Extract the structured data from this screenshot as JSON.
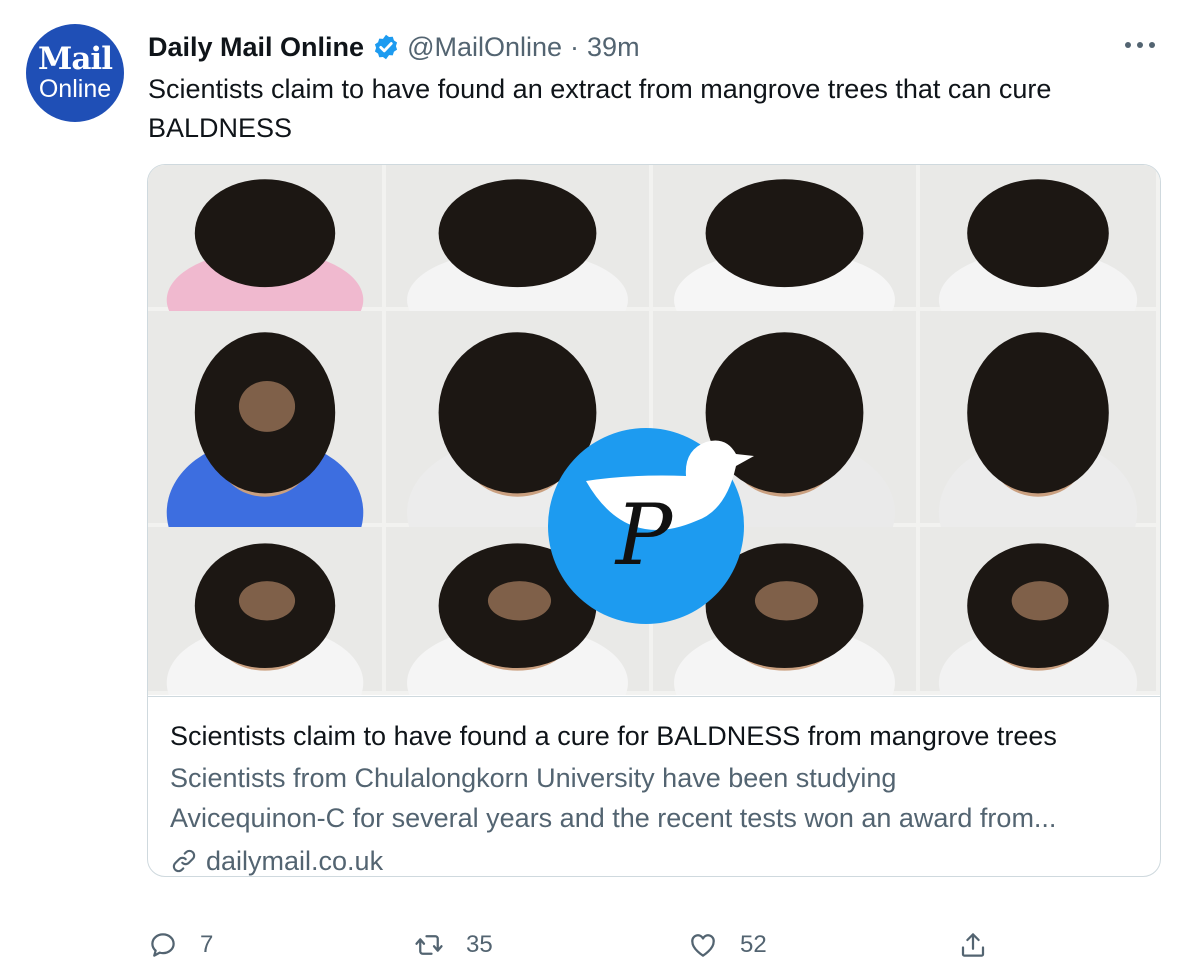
{
  "account": {
    "avatar_line1": "Mail",
    "avatar_line2": "Online",
    "name": "Daily Mail Online",
    "handle": "@MailOnline",
    "separator": "·",
    "time": "39m"
  },
  "tweet": {
    "text": "Scientists claim to have found an extract from mangrove trees that can cure BALDNESS"
  },
  "card": {
    "title": "Scientists claim to have found a cure for BALDNESS from mangrove trees",
    "description_line1": "Scientists from  Chulalongkorn University have been studying",
    "description_line2": "Avicequinon-C for several years and the recent tests won an award from...",
    "domain": "dailymail.co.uk"
  },
  "watermark": {
    "letter": "P",
    "color": "#1d9bf0"
  },
  "actions": {
    "replies": "7",
    "retweets": "35",
    "likes": "52"
  },
  "icons": [
    "verified-badge-icon",
    "more-icon",
    "link-icon",
    "reply-icon",
    "retweet-icon",
    "like-icon",
    "share-icon",
    "twitter-bird-icon"
  ],
  "colors": {
    "text": "#0f1419",
    "muted": "#536471",
    "border": "#cfd9de",
    "verified": "#1d9bf0",
    "avatar": "#1f4fb6"
  }
}
